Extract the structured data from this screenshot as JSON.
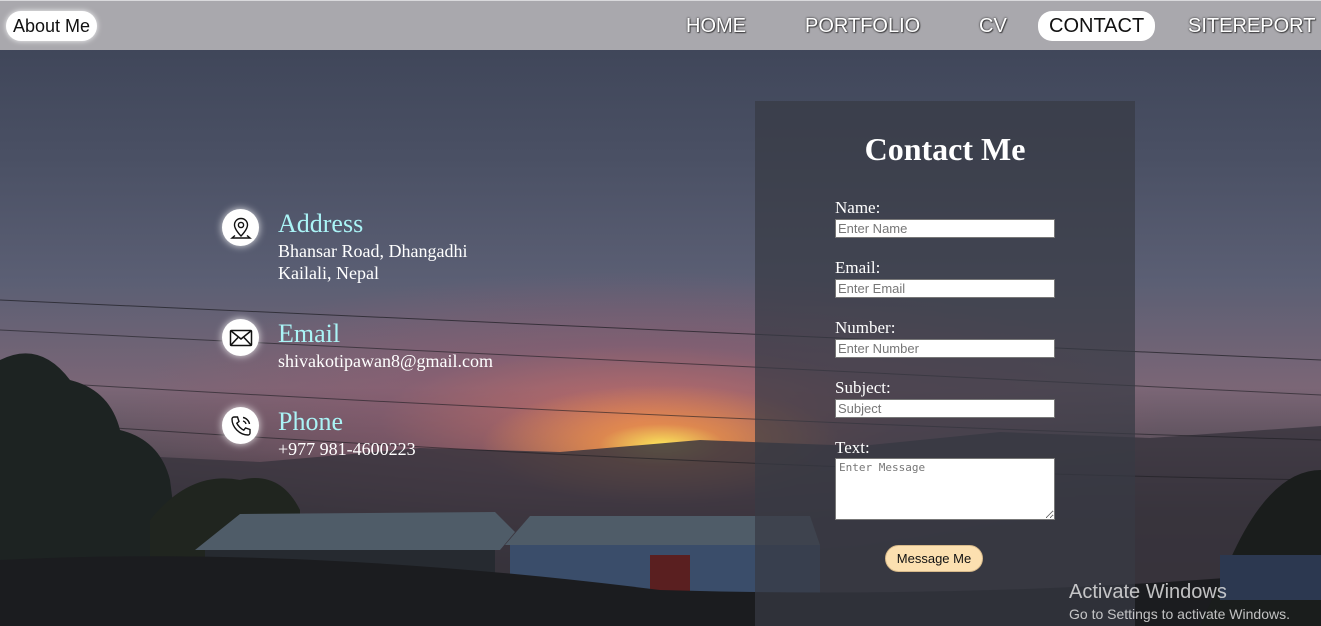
{
  "navbar": {
    "brand": "About Me",
    "items": [
      {
        "label": "HOME",
        "active": false
      },
      {
        "label": "PORTFOLIO",
        "active": false
      },
      {
        "label": "CV",
        "active": false
      },
      {
        "label": "CONTACT",
        "active": true
      },
      {
        "label": "SITEREPORT",
        "active": false
      }
    ]
  },
  "contact_info": {
    "address": {
      "icon": "map-pin-icon",
      "title": "Address",
      "line1": "Bhansar Road, Dhangadhi",
      "line2": "Kailali, Nepal"
    },
    "email": {
      "icon": "envelope-icon",
      "title": "Email",
      "value": "shivakotipawan8@gmail.com"
    },
    "phone": {
      "icon": "phone-icon",
      "title": "Phone",
      "value": "+977 981-4600223"
    }
  },
  "form": {
    "title": "Contact Me",
    "fields": {
      "name": {
        "label": "Name:",
        "placeholder": "Enter Name",
        "value": ""
      },
      "email": {
        "label": "Email:",
        "placeholder": "Enter Email",
        "value": ""
      },
      "number": {
        "label": "Number:",
        "placeholder": "Enter Number",
        "value": ""
      },
      "subject": {
        "label": "Subject:",
        "placeholder": "Subject",
        "value": ""
      },
      "text": {
        "label": "Text:",
        "placeholder": "Enter Message",
        "value": ""
      }
    },
    "submit_label": "Message Me"
  },
  "watermark": {
    "title": "Activate Windows",
    "subtitle": "Go to Settings to activate Windows."
  },
  "colors": {
    "navbar_bg": "#a9a8ad",
    "info_title": "#aaf4f6",
    "button_bg": "#fce0b0"
  }
}
